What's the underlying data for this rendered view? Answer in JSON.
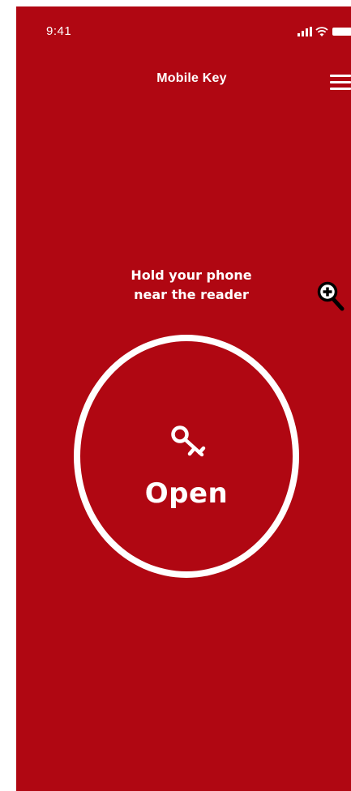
{
  "status_bar": {
    "time": "9:41",
    "icons": [
      "signal-icon",
      "wifi-icon",
      "battery-icon"
    ]
  },
  "nav": {
    "title": "Mobile Key",
    "menu_icon": "hamburger-menu-icon"
  },
  "instruction": {
    "line1": "Hold your phone",
    "line2": "near the reader"
  },
  "open_button": {
    "label": "Open",
    "icon": "key-icon"
  },
  "overlay": {
    "icon": "zoom-in-icon"
  },
  "colors": {
    "background": "#b00712",
    "foreground": "#ffffff"
  }
}
